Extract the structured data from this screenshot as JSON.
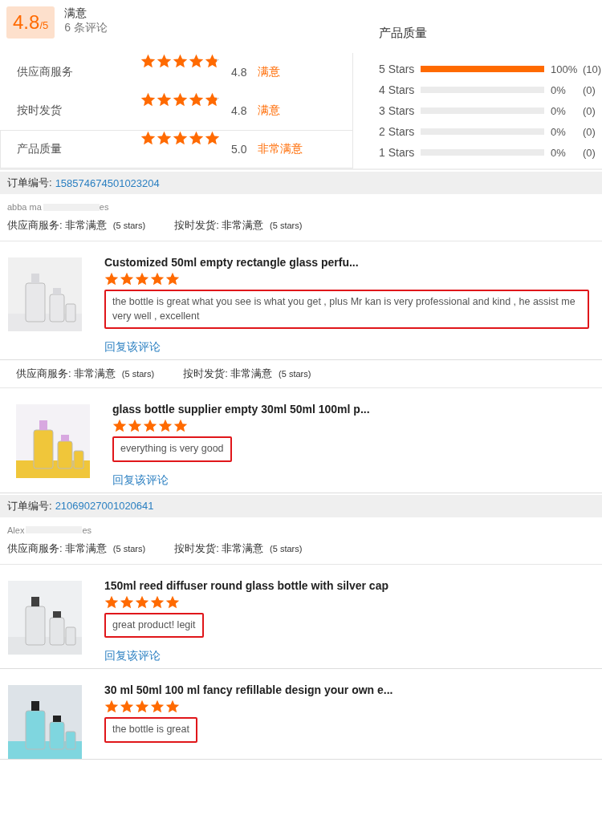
{
  "summary": {
    "score": "4.8",
    "out_of": "/5",
    "verdict": "满意",
    "count": "6 条评论",
    "criteria": [
      {
        "name": "供应商服务",
        "stars": 4.8,
        "score": "4.8",
        "verdict": "满意",
        "selected": false
      },
      {
        "name": "按时发货",
        "stars": 4.8,
        "score": "4.8",
        "verdict": "满意",
        "selected": false
      },
      {
        "name": "产品质量",
        "stars": 5,
        "score": "5.0",
        "verdict": "非常满意",
        "selected": true
      }
    ]
  },
  "distribution": {
    "title": "产品质量",
    "rows": [
      {
        "label": "5 Stars",
        "level": 1,
        "percent": "100%",
        "count": "(10)"
      },
      {
        "label": "4 Stars",
        "level": 0,
        "percent": "0%",
        "count": "(0)"
      },
      {
        "label": "3 Stars",
        "level": 0,
        "percent": "0%",
        "count": "(0)"
      },
      {
        "label": "2 Stars",
        "level": 0,
        "percent": "0%",
        "count": "(0)"
      },
      {
        "label": "1 Stars",
        "level": 0,
        "percent": "0%",
        "count": "(0)"
      }
    ]
  },
  "orders": [
    {
      "label": "订单编号:",
      "number": "158574674501023204",
      "reviewer": "abba ma",
      "reviewer_end": "es",
      "ratings": [
        {
          "label": "供应商服务:",
          "value": "非常满意",
          "stars": "(5 stars)"
        },
        {
          "label": "按时发货:",
          "value": "非常满意",
          "stars": "(5 stars)"
        }
      ],
      "items": [
        {
          "title": "Customized 50ml empty rectangle glass perfu...",
          "stars": 5,
          "comment": "the bottle is great what you see is what you get , plus Mr kan is very professional and kind , he assist me very well , excellent",
          "reply": "回复该评论",
          "indented": false
        },
        {
          "ratings": [
            {
              "label": "供应商服务:",
              "value": "非常满意",
              "stars": "(5 stars)"
            },
            {
              "label": "按时发货:",
              "value": "非常满意",
              "stars": "(5 stars)"
            }
          ],
          "title": "glass bottle supplier empty 30ml 50ml 100ml p...",
          "stars": 5,
          "comment": "everything is very good",
          "reply": "回复该评论",
          "indented": true
        }
      ]
    },
    {
      "label": "订单编号:",
      "number": "21069027001020641",
      "reviewer": "Alex",
      "reviewer_end": "es",
      "ratings": [
        {
          "label": "供应商服务:",
          "value": "非常满意",
          "stars": "(5 stars)"
        },
        {
          "label": "按时发货:",
          "value": "非常满意",
          "stars": "(5 stars)"
        }
      ],
      "items": [
        {
          "title": "150ml reed diffuser round glass bottle with silver cap",
          "stars": 5,
          "comment": "great product! legit",
          "reply": "回复该评论",
          "indented": false
        },
        {
          "title": "30 ml 50ml 100 ml fancy refillable design your own e...",
          "stars": 5,
          "comment": "the bottle is great",
          "indented": false
        }
      ]
    }
  ]
}
